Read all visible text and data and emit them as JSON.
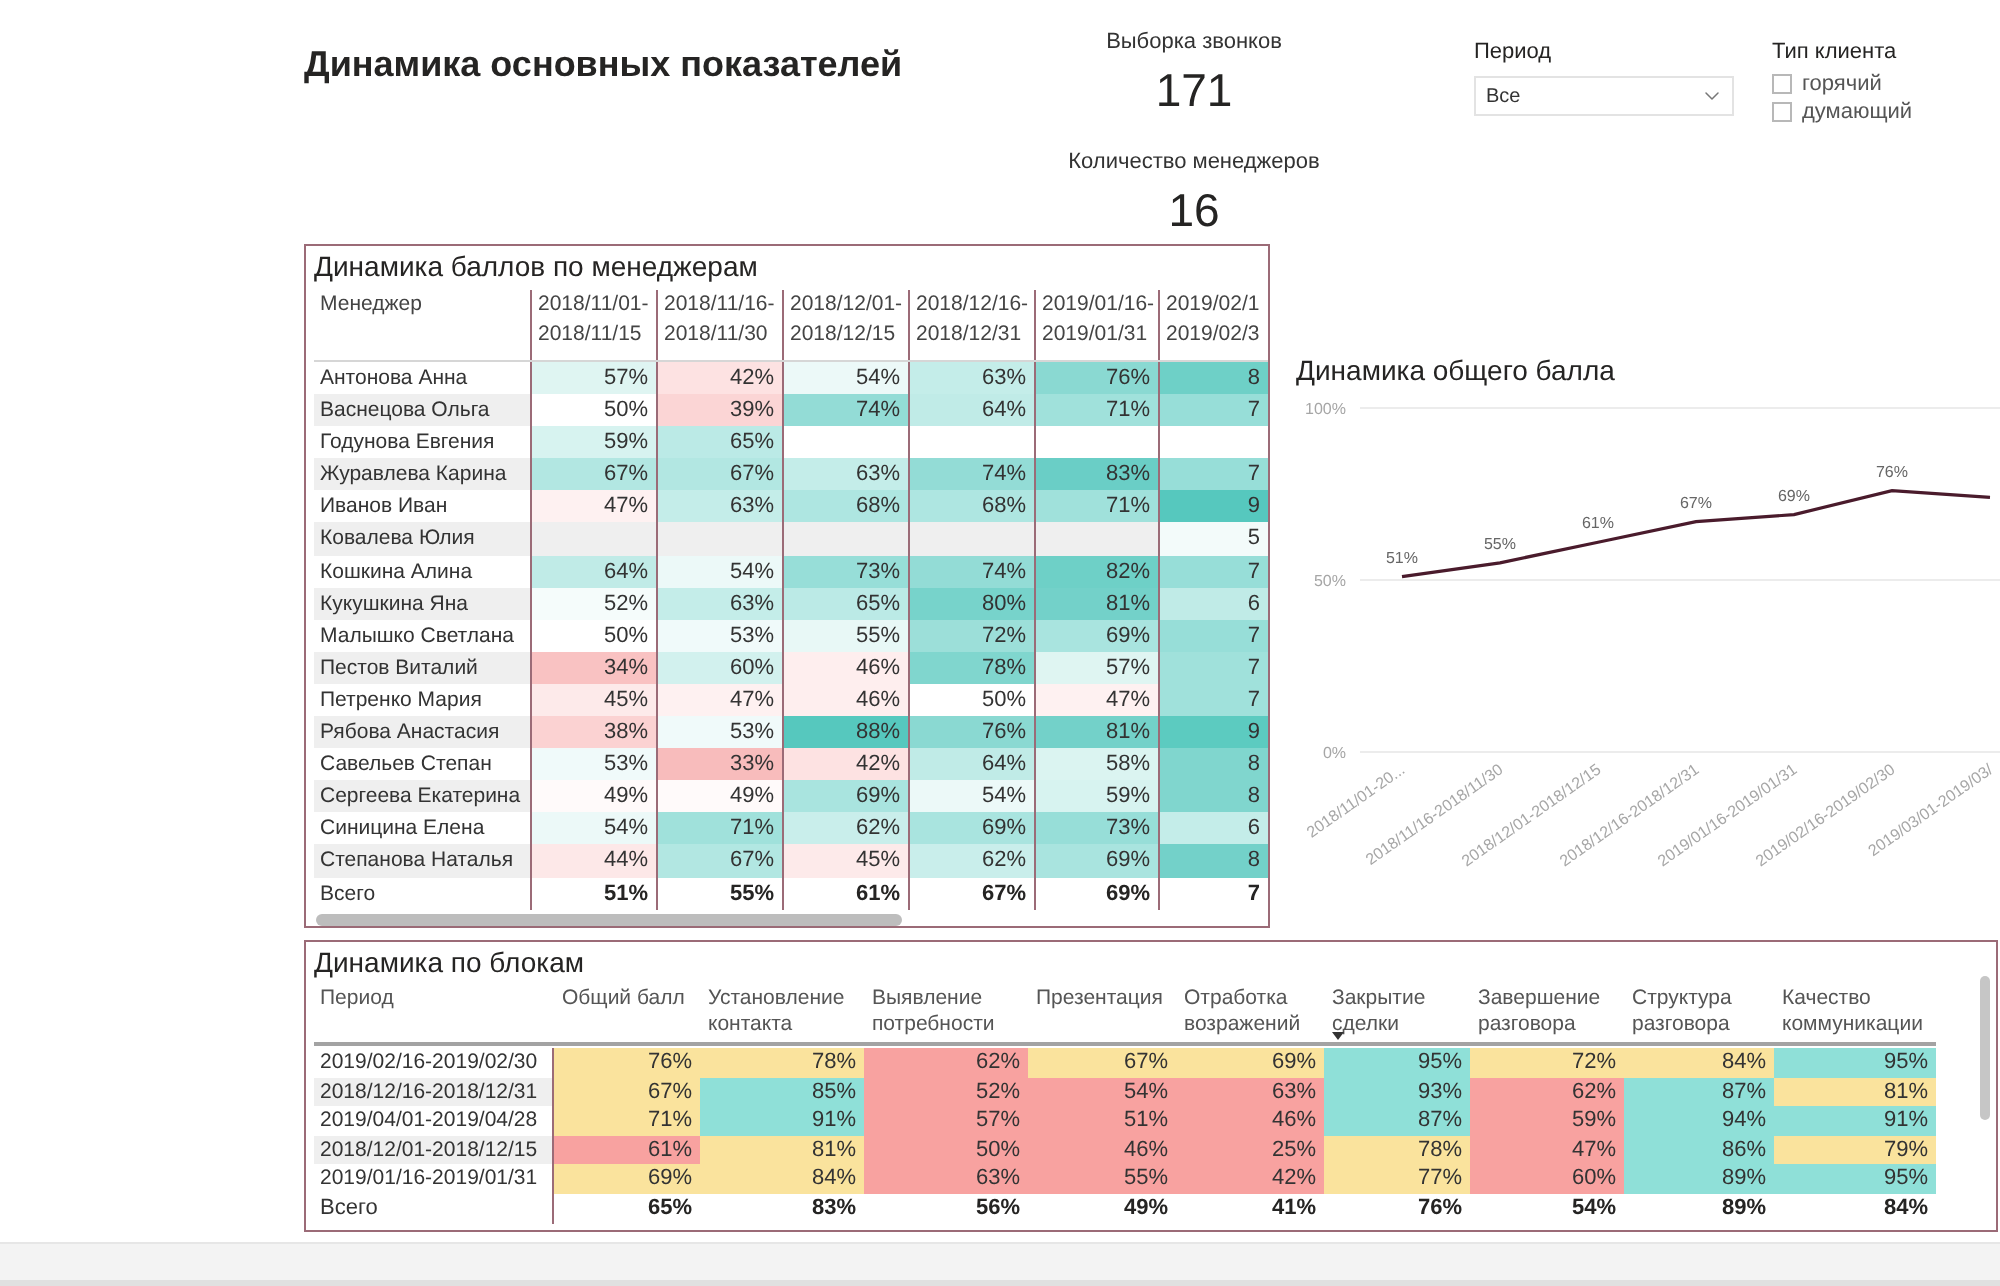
{
  "header": {
    "title": "Динамика основных показателей"
  },
  "kpis": [
    {
      "label": "Выборка звонков",
      "value": "171"
    },
    {
      "label": "Количество менеджеров",
      "value": "16"
    }
  ],
  "filters": {
    "period": {
      "label": "Период",
      "value": "Все"
    },
    "client_type": {
      "label": "Тип клиента",
      "options": [
        {
          "label": "горячий",
          "checked": false
        },
        {
          "label": "думающий",
          "checked": false
        }
      ]
    }
  },
  "manager_table": {
    "title": "Динамика баллов по менеджерам",
    "name_column": {
      "lines": [
        "Менеджер"
      ]
    },
    "columns": [
      {
        "lines": [
          "2018/11/01-",
          "2018/11/15"
        ]
      },
      {
        "lines": [
          "2018/11/16-",
          "2018/11/30"
        ]
      },
      {
        "lines": [
          "2018/12/01-",
          "2018/12/15"
        ]
      },
      {
        "lines": [
          "2018/12/16-",
          "2018/12/31"
        ]
      },
      {
        "lines": [
          "2019/01/16-",
          "2019/01/31"
        ]
      },
      {
        "lines": [
          "2019/02/1",
          "2019/02/3"
        ]
      }
    ],
    "rows": [
      {
        "name": "Антонова Анна",
        "cells": [
          {
            "value": "57%",
            "color": "#dff5f2"
          },
          {
            "value": "42%",
            "color": "#fde2e2"
          },
          {
            "value": "54%",
            "color": "#ecf9f8"
          },
          {
            "value": "63%",
            "color": "#c4ede9"
          },
          {
            "value": "76%",
            "color": "#8ad9d2"
          },
          {
            "value": "8",
            "color": "#6ed0c7"
          }
        ]
      },
      {
        "name": "Васнецова Ольга",
        "cells": [
          {
            "value": "50%",
            "color": "#ffffff"
          },
          {
            "value": "39%",
            "color": "#fbd5d5"
          },
          {
            "value": "74%",
            "color": "#93dcd6"
          },
          {
            "value": "64%",
            "color": "#c0ebe7"
          },
          {
            "value": "71%",
            "color": "#a0e1db"
          },
          {
            "value": "7",
            "color": "#97ded8"
          }
        ]
      },
      {
        "name": "Годунова Евгения",
        "cells": [
          {
            "value": "59%",
            "color": "#d7f3f0"
          },
          {
            "value": "65%",
            "color": "#bbeae6"
          },
          null,
          null,
          null,
          null
        ]
      },
      {
        "name": "Журавлева Карина",
        "cells": [
          {
            "value": "67%",
            "color": "#b2e7e2"
          },
          {
            "value": "67%",
            "color": "#b2e7e2"
          },
          {
            "value": "63%",
            "color": "#c4ede9"
          },
          {
            "value": "74%",
            "color": "#93dcd6"
          },
          {
            "value": "83%",
            "color": "#6acec6"
          },
          {
            "value": "7",
            "color": "#97ded8"
          }
        ]
      },
      {
        "name": "Иванов Иван",
        "cells": [
          {
            "value": "47%",
            "color": "#fef1f1"
          },
          {
            "value": "63%",
            "color": "#c4ede9"
          },
          {
            "value": "68%",
            "color": "#aee6e1"
          },
          {
            "value": "68%",
            "color": "#aee6e1"
          },
          {
            "value": "71%",
            "color": "#a0e1db"
          },
          {
            "value": "9",
            "color": "#56c8be"
          }
        ]
      },
      {
        "name": "Ковалева Юлия",
        "cells": [
          null,
          null,
          null,
          null,
          null,
          {
            "value": "5",
            "color": "#f3fbfa"
          }
        ]
      },
      {
        "name": "Кошкина Алина",
        "cells": [
          {
            "value": "64%",
            "color": "#c0ebe7"
          },
          {
            "value": "54%",
            "color": "#ecf9f8"
          },
          {
            "value": "73%",
            "color": "#97ded8"
          },
          {
            "value": "74%",
            "color": "#93dcd6"
          },
          {
            "value": "82%",
            "color": "#6ed0c7"
          },
          {
            "value": "7",
            "color": "#97ded8"
          }
        ]
      },
      {
        "name": "Кукушкина Яна",
        "cells": [
          {
            "value": "52%",
            "color": "#f5fcfb"
          },
          {
            "value": "63%",
            "color": "#c4ede9"
          },
          {
            "value": "65%",
            "color": "#bbeae6"
          },
          {
            "value": "80%",
            "color": "#77d3cb"
          },
          {
            "value": "81%",
            "color": "#73d1c9"
          },
          {
            "value": "6",
            "color": "#c0ebe7"
          }
        ]
      },
      {
        "name": "Малышко Светлана",
        "cells": [
          {
            "value": "50%",
            "color": "#ffffff"
          },
          {
            "value": "53%",
            "color": "#f0fafa"
          },
          {
            "value": "55%",
            "color": "#e8f8f6"
          },
          {
            "value": "72%",
            "color": "#9cdfd9"
          },
          {
            "value": "69%",
            "color": "#a9e4df"
          },
          {
            "value": "7",
            "color": "#97ded8"
          }
        ]
      },
      {
        "name": "Пестов Виталий",
        "cells": [
          {
            "value": "34%",
            "color": "#f9c2c2"
          },
          {
            "value": "60%",
            "color": "#d2f1ee"
          },
          {
            "value": "46%",
            "color": "#feeeee"
          },
          {
            "value": "78%",
            "color": "#80d6ce"
          },
          {
            "value": "57%",
            "color": "#dff5f2"
          },
          {
            "value": "7",
            "color": "#a0e1db"
          }
        ]
      },
      {
        "name": "Петренко Мария",
        "cells": [
          {
            "value": "45%",
            "color": "#fdeaea"
          },
          {
            "value": "47%",
            "color": "#fef1f1"
          },
          {
            "value": "46%",
            "color": "#feeeee"
          },
          {
            "value": "50%",
            "color": "#ffffff"
          },
          {
            "value": "47%",
            "color": "#fef1f1"
          },
          {
            "value": "7",
            "color": "#a0e1db"
          }
        ]
      },
      {
        "name": "Рябова Анастасия",
        "cells": [
          {
            "value": "38%",
            "color": "#fbd2d2"
          },
          {
            "value": "53%",
            "color": "#f0fafa"
          },
          {
            "value": "88%",
            "color": "#56c8be"
          },
          {
            "value": "76%",
            "color": "#8ad9d2"
          },
          {
            "value": "81%",
            "color": "#73d1c9"
          },
          {
            "value": "9",
            "color": "#5ccbc0"
          }
        ]
      },
      {
        "name": "Савельев Степан",
        "cells": [
          {
            "value": "53%",
            "color": "#f0fafa"
          },
          {
            "value": "33%",
            "color": "#f8bcbc"
          },
          {
            "value": "42%",
            "color": "#fde2e2"
          },
          {
            "value": "64%",
            "color": "#c0ebe7"
          },
          {
            "value": "58%",
            "color": "#dbf4f1"
          },
          {
            "value": "8",
            "color": "#80d6ce"
          }
        ]
      },
      {
        "name": "Сергеева Екатерина",
        "cells": [
          {
            "value": "49%",
            "color": "#fffafa"
          },
          {
            "value": "49%",
            "color": "#fffafa"
          },
          {
            "value": "69%",
            "color": "#a9e4df"
          },
          {
            "value": "54%",
            "color": "#ecf9f8"
          },
          {
            "value": "59%",
            "color": "#d7f3f0"
          },
          {
            "value": "8",
            "color": "#80d6ce"
          }
        ]
      },
      {
        "name": "Синицина Елена",
        "cells": [
          {
            "value": "54%",
            "color": "#ecf9f8"
          },
          {
            "value": "71%",
            "color": "#a0e1db"
          },
          {
            "value": "62%",
            "color": "#c9eeeb"
          },
          {
            "value": "69%",
            "color": "#a9e4df"
          },
          {
            "value": "73%",
            "color": "#97ded8"
          },
          {
            "value": "6",
            "color": "#c4ede9"
          }
        ]
      },
      {
        "name": "Степанова Наталья",
        "cells": [
          {
            "value": "44%",
            "color": "#fde8e8"
          },
          {
            "value": "67%",
            "color": "#b2e7e2"
          },
          {
            "value": "45%",
            "color": "#fdeaea"
          },
          {
            "value": "62%",
            "color": "#c9eeeb"
          },
          {
            "value": "69%",
            "color": "#a9e4df"
          },
          {
            "value": "8",
            "color": "#73d1c9"
          }
        ]
      }
    ],
    "total": {
      "label": "Всего",
      "values": [
        "51%",
        "55%",
        "61%",
        "67%",
        "69%",
        "7"
      ]
    }
  },
  "trend_chart": {
    "chart_data": {
      "type": "line",
      "title": "Динамика общего балла",
      "categories": [
        "2018/11/01-20...",
        "2018/11/16-2018/11/30",
        "2018/12/01-2018/12/15",
        "2018/12/16-2018/12/31",
        "2019/01/16-2019/01/31",
        "2019/02/16-2019/02/30",
        "2019/03/01-2019/03/"
      ],
      "values": [
        51,
        55,
        61,
        67,
        69,
        76,
        74
      ],
      "ylim": [
        0,
        100
      ],
      "yticks": [
        {
          "value": 0,
          "label": "0%"
        },
        {
          "value": 50,
          "label": "50%"
        },
        {
          "value": 100,
          "label": "100%"
        }
      ],
      "value_labels": [
        "51%",
        "55%",
        "61%",
        "67%",
        "69%",
        "76%",
        null
      ]
    }
  },
  "blocks_table": {
    "title": "Динамика по блокам",
    "period_column": {
      "label": "Период"
    },
    "columns": [
      {
        "label": "Общий балл",
        "sorted": false
      },
      {
        "label": "Установление контакта",
        "sorted": false
      },
      {
        "label": "Выявление потребности",
        "sorted": false
      },
      {
        "label": "Презентация",
        "sorted": false
      },
      {
        "label": "Отработка возражений",
        "sorted": false
      },
      {
        "label": "Закрытие сделки",
        "sorted": true
      },
      {
        "label": "Завершение разговора",
        "sorted": false
      },
      {
        "label": "Структура разговора",
        "sorted": false
      },
      {
        "label": "Качество коммуникации",
        "sorted": false
      }
    ],
    "rows": [
      {
        "period": "2019/02/16-2019/02/30",
        "cells": [
          {
            "value": "76%",
            "color": "#fae39d"
          },
          {
            "value": "78%",
            "color": "#fae39d"
          },
          {
            "value": "62%",
            "color": "#f8a2a0"
          },
          {
            "value": "67%",
            "color": "#fae39d"
          },
          {
            "value": "69%",
            "color": "#fae39d"
          },
          {
            "value": "95%",
            "color": "#8fe0d8"
          },
          {
            "value": "72%",
            "color": "#fae39d"
          },
          {
            "value": "84%",
            "color": "#fae39d"
          },
          {
            "value": "95%",
            "color": "#8fe0d8"
          }
        ]
      },
      {
        "period": "2018/12/16-2018/12/31",
        "cells": [
          {
            "value": "67%",
            "color": "#fae39d"
          },
          {
            "value": "85%",
            "color": "#8fe0d8"
          },
          {
            "value": "52%",
            "color": "#f8a2a0"
          },
          {
            "value": "54%",
            "color": "#f8a2a0"
          },
          {
            "value": "63%",
            "color": "#f8a2a0"
          },
          {
            "value": "93%",
            "color": "#8fe0d8"
          },
          {
            "value": "62%",
            "color": "#f8a2a0"
          },
          {
            "value": "87%",
            "color": "#8fe0d8"
          },
          {
            "value": "81%",
            "color": "#fae39d"
          }
        ]
      },
      {
        "period": "2019/04/01-2019/04/28",
        "cells": [
          {
            "value": "71%",
            "color": "#fae39d"
          },
          {
            "value": "91%",
            "color": "#8fe0d8"
          },
          {
            "value": "57%",
            "color": "#f8a2a0"
          },
          {
            "value": "51%",
            "color": "#f8a2a0"
          },
          {
            "value": "46%",
            "color": "#f8a2a0"
          },
          {
            "value": "87%",
            "color": "#8fe0d8"
          },
          {
            "value": "59%",
            "color": "#f8a2a0"
          },
          {
            "value": "94%",
            "color": "#8fe0d8"
          },
          {
            "value": "91%",
            "color": "#8fe0d8"
          }
        ]
      },
      {
        "period": "2018/12/01-2018/12/15",
        "cells": [
          {
            "value": "61%",
            "color": "#f8a2a0"
          },
          {
            "value": "81%",
            "color": "#fae39d"
          },
          {
            "value": "50%",
            "color": "#f8a2a0"
          },
          {
            "value": "46%",
            "color": "#f8a2a0"
          },
          {
            "value": "25%",
            "color": "#f8a2a0"
          },
          {
            "value": "78%",
            "color": "#fae39d"
          },
          {
            "value": "47%",
            "color": "#f8a2a0"
          },
          {
            "value": "86%",
            "color": "#8fe0d8"
          },
          {
            "value": "79%",
            "color": "#fae39d"
          }
        ]
      },
      {
        "period": "2019/01/16-2019/01/31",
        "cells": [
          {
            "value": "69%",
            "color": "#fae39d"
          },
          {
            "value": "84%",
            "color": "#fae39d"
          },
          {
            "value": "63%",
            "color": "#f8a2a0"
          },
          {
            "value": "55%",
            "color": "#f8a2a0"
          },
          {
            "value": "42%",
            "color": "#f8a2a0"
          },
          {
            "value": "77%",
            "color": "#fae39d"
          },
          {
            "value": "60%",
            "color": "#f8a2a0"
          },
          {
            "value": "89%",
            "color": "#8fe0d8"
          },
          {
            "value": "95%",
            "color": "#8fe0d8"
          }
        ]
      }
    ],
    "total": {
      "label": "Всего",
      "values": [
        "65%",
        "83%",
        "56%",
        "49%",
        "41%",
        "76%",
        "54%",
        "89%",
        "84%"
      ]
    }
  }
}
